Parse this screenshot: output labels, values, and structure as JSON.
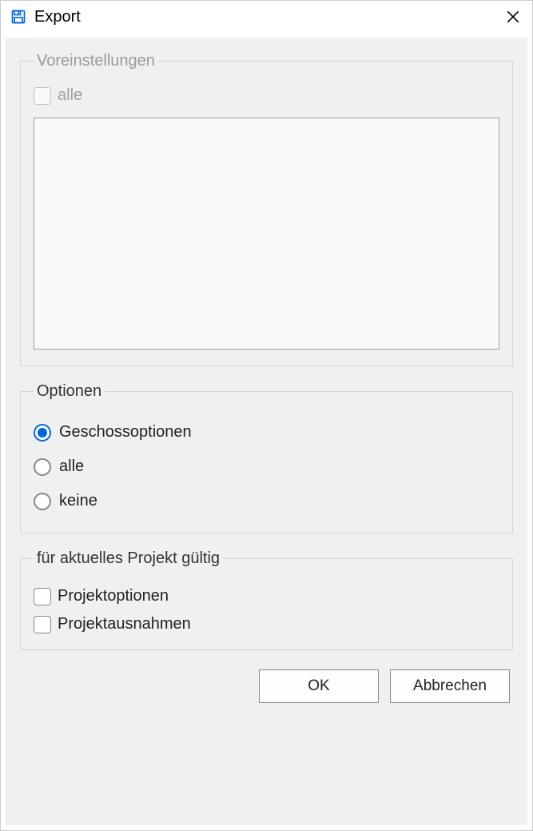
{
  "titlebar": {
    "title": "Export"
  },
  "presets": {
    "legend": "Voreinstellungen",
    "all_label": "alle"
  },
  "options": {
    "legend": "Optionen",
    "items": [
      {
        "label": "Geschossoptionen",
        "selected": true
      },
      {
        "label": "alle",
        "selected": false
      },
      {
        "label": "keine",
        "selected": false
      }
    ]
  },
  "project": {
    "legend": "für aktuelles Projekt gültig",
    "projektoptionen_label": "Projektoptionen",
    "projektausnahmen_label": "Projektausnahmen"
  },
  "buttons": {
    "ok": "OK",
    "cancel": "Abbrechen"
  }
}
